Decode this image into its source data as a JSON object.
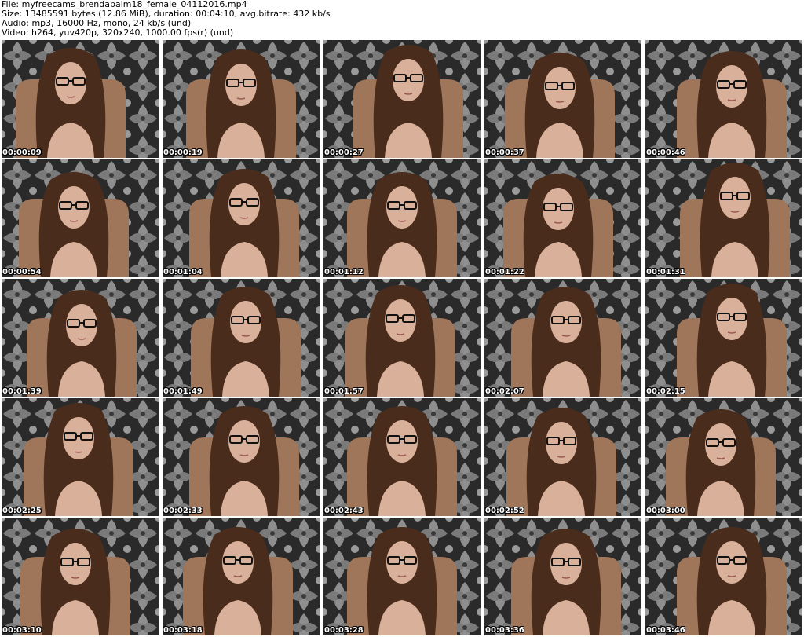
{
  "header": {
    "file": "File: myfreecams_brendabalm18_female_04112016.mp4",
    "size": "Size: 13485591 bytes (12.86 MiB), duration: 00:04:10, avg.bitrate: 432 kb/s",
    "audio": "Audio: mp3, 16000 Hz, mono, 24 kb/s (und)",
    "video": "Video: h264, yuv420p, 320x240, 1000.00 fps(r) (und)"
  },
  "thumbnails": [
    {
      "timestamp": "00:00:09"
    },
    {
      "timestamp": "00:00:19"
    },
    {
      "timestamp": "00:00:27"
    },
    {
      "timestamp": "00:00:37"
    },
    {
      "timestamp": "00:00:46"
    },
    {
      "timestamp": "00:00:54"
    },
    {
      "timestamp": "00:01:04"
    },
    {
      "timestamp": "00:01:12"
    },
    {
      "timestamp": "00:01:22"
    },
    {
      "timestamp": "00:01:31"
    },
    {
      "timestamp": "00:01:39"
    },
    {
      "timestamp": "00:01:49"
    },
    {
      "timestamp": "00:01:57"
    },
    {
      "timestamp": "00:02:07"
    },
    {
      "timestamp": "00:02:15"
    },
    {
      "timestamp": "00:02:25"
    },
    {
      "timestamp": "00:02:33"
    },
    {
      "timestamp": "00:02:43"
    },
    {
      "timestamp": "00:02:52"
    },
    {
      "timestamp": "00:03:00"
    },
    {
      "timestamp": "00:03:10"
    },
    {
      "timestamp": "00:03:18"
    },
    {
      "timestamp": "00:03:28"
    },
    {
      "timestamp": "00:03:36"
    },
    {
      "timestamp": "00:03:46"
    }
  ],
  "colors": {
    "wallpaper_dark": "#2a2a2a",
    "wallpaper_light": "#9a9a9a",
    "hair": "#4a2c1c",
    "skin": "#d9b09a",
    "chair": "#a0765a",
    "timestamp_text": "#ffffff"
  }
}
